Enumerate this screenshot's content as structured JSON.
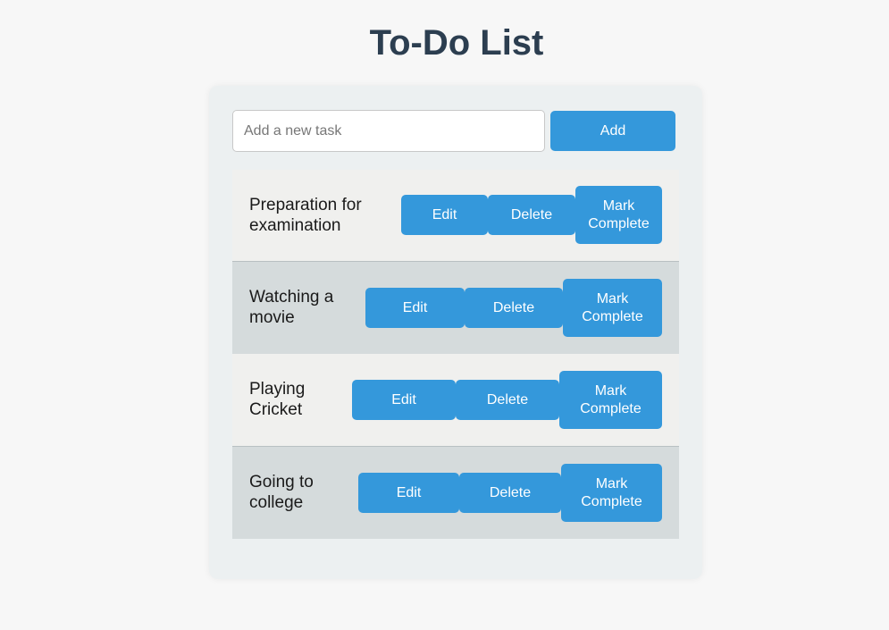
{
  "header": {
    "title": "To-Do List"
  },
  "input": {
    "placeholder": "Add a new task",
    "add_label": "Add"
  },
  "tasks": [
    {
      "line1": "Preparation for",
      "line2": "examination",
      "edit": "Edit",
      "delete": "Delete",
      "complete1": "Mark",
      "complete2": "Complete"
    },
    {
      "line1": "Watching a",
      "line2": "movie",
      "edit": "Edit",
      "delete": "Delete",
      "complete1": "Mark",
      "complete2": "Complete"
    },
    {
      "line1": "Playing",
      "line2": "Cricket",
      "edit": "Edit",
      "delete": "Delete",
      "complete1": "Mark",
      "complete2": "Complete"
    },
    {
      "line1": "Going to",
      "line2": "college",
      "edit": "Edit",
      "delete": "Delete",
      "complete1": "Mark",
      "complete2": "Complete"
    }
  ],
  "colors": {
    "accent": "#3498db",
    "title": "#2c3e50",
    "card": "#ecf0f1",
    "row_light": "#f0f0ee",
    "row_dark": "#d5dbdc"
  }
}
